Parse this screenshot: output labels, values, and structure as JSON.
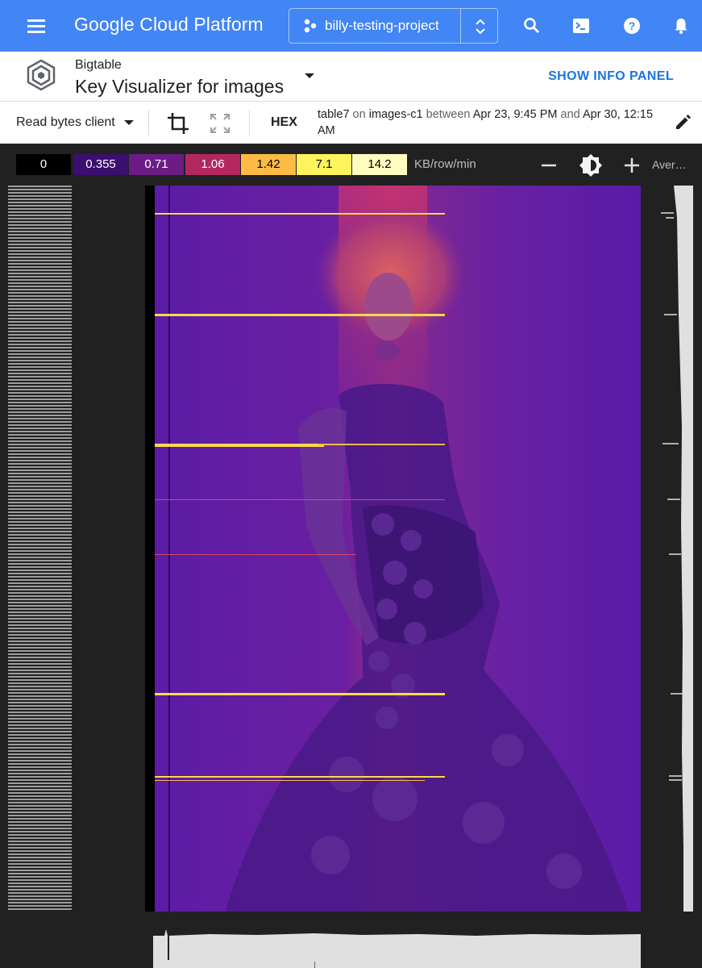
{
  "topbar": {
    "brand": "Google Cloud Platform",
    "project": "billy-testing-project",
    "icons": [
      "menu-icon",
      "search-icon",
      "cloud-shell-icon",
      "help-icon",
      "notifications-icon"
    ]
  },
  "header": {
    "product": "Bigtable",
    "title": "Key Visualizer for images",
    "info_panel": "SHOW INFO PANEL"
  },
  "toolbar": {
    "metric": "Read bytes client",
    "hex": "HEX",
    "table": "table7",
    "on": "on",
    "instance": "images-c1",
    "between": "between",
    "start": "Apr 23, 9:45 PM",
    "and": "and",
    "end": "Apr 30, 12:15 AM"
  },
  "legend": {
    "scale": [
      {
        "label": "0",
        "color": "#000000",
        "text": "#ffffff"
      },
      {
        "label": "0.355",
        "color": "#3a0f6e",
        "text": "#ffffff"
      },
      {
        "label": "0.71",
        "color": "#6b1d85",
        "text": "#ffffff"
      },
      {
        "label": "1.06",
        "color": "#b3275f",
        "text": "#ffffff"
      },
      {
        "label": "1.42",
        "color": "#fdbb45",
        "text": "#000000"
      },
      {
        "label": "7.1",
        "color": "#fdf35c",
        "text": "#000000"
      },
      {
        "label": "14.2",
        "color": "#fffcbf",
        "text": "#000000"
      }
    ],
    "unit": "KB/row/min",
    "aggregation": "Aver…"
  },
  "colors": {
    "gcp_blue": "#4285f4",
    "link_blue": "#1a73e8",
    "heatmap_base": "#5a1fa8",
    "heatmap_hot": "#fdd94a"
  }
}
